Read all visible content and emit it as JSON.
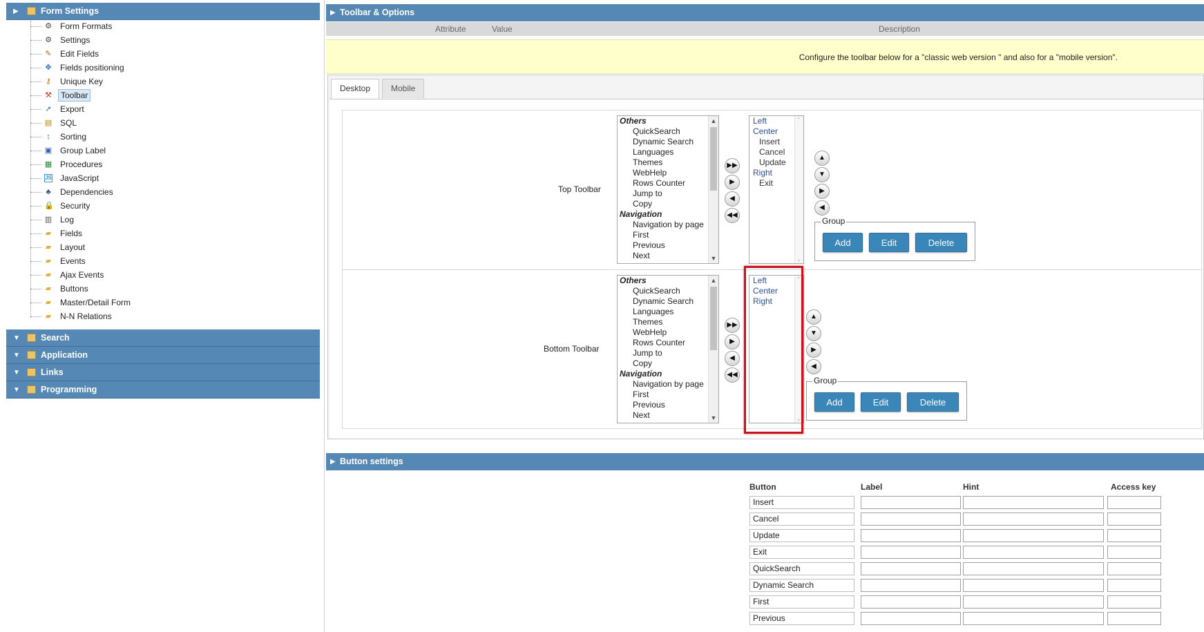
{
  "left": {
    "header": "Form Settings",
    "items": [
      {
        "label": "Form Formats",
        "icon": "gear-icon",
        "glyph": "⚙",
        "color": "#444"
      },
      {
        "label": "Settings",
        "icon": "gear-icon",
        "glyph": "⚙",
        "color": "#444"
      },
      {
        "label": "Edit Fields",
        "icon": "pencil-icon",
        "glyph": "✎",
        "color": "#b5651d"
      },
      {
        "label": "Fields positioning",
        "icon": "move-icon",
        "glyph": "✥",
        "color": "#2d6fb7"
      },
      {
        "label": "Unique Key",
        "icon": "key-icon",
        "glyph": "⚷",
        "color": "#b08a00"
      },
      {
        "label": "Toolbar",
        "icon": "tools-icon",
        "glyph": "⚒",
        "color": "#c0392b",
        "selected": true
      },
      {
        "label": "Export",
        "icon": "export-icon",
        "glyph": "➚",
        "color": "#2d6fb7"
      },
      {
        "label": "SQL",
        "icon": "database-icon",
        "glyph": "▤",
        "color": "#b08a00"
      },
      {
        "label": "Sorting",
        "icon": "sort-icon",
        "glyph": "↕",
        "color": "#1a9a7a"
      },
      {
        "label": "Group Label",
        "icon": "group-label-icon",
        "glyph": "▣",
        "color": "#2d5fb7"
      },
      {
        "label": "Procedures",
        "icon": "procedure-icon",
        "glyph": "▦",
        "color": "#2e8b3a"
      },
      {
        "label": "JavaScript",
        "icon": "javascript-icon",
        "glyph": "JS",
        "color": "#3a8fd0"
      },
      {
        "label": "Dependencies",
        "icon": "dependency-icon",
        "glyph": "♣",
        "color": "#3a4f8a"
      },
      {
        "label": "Security",
        "icon": "lock-icon",
        "glyph": "🔒",
        "color": "#b08a00"
      },
      {
        "label": "Log",
        "icon": "log-icon",
        "glyph": "▥",
        "color": "#555"
      },
      {
        "label": "Fields",
        "icon": "folder-icon",
        "glyph": "▰",
        "color": "#e0b040"
      },
      {
        "label": "Layout",
        "icon": "folder-icon",
        "glyph": "▰",
        "color": "#e0b040"
      },
      {
        "label": "Events",
        "icon": "folder-icon",
        "glyph": "▰",
        "color": "#e0b040"
      },
      {
        "label": "Ajax Events",
        "icon": "folder-icon",
        "glyph": "▰",
        "color": "#e0b040"
      },
      {
        "label": "Buttons",
        "icon": "folder-icon",
        "glyph": "▰",
        "color": "#e0b040"
      },
      {
        "label": "Master/Detail Form",
        "icon": "folder-icon",
        "glyph": "▰",
        "color": "#e0b040"
      },
      {
        "label": "N-N Relations",
        "icon": "folder-icon",
        "glyph": "▰",
        "color": "#e0b040"
      }
    ],
    "sections": [
      "Search",
      "Application",
      "Links",
      "Programming"
    ]
  },
  "toolbar_options": {
    "header": "Toolbar & Options",
    "col_attribute": "Attribute",
    "col_value": "Value",
    "col_description": "Description",
    "info": "Configure the toolbar below for a \"classic web version \" and also for a \"mobile version\".",
    "tabs": [
      "Desktop",
      "Mobile"
    ],
    "top_label": "Top Toolbar",
    "bottom_label": "Bottom Toolbar",
    "available": [
      {
        "text": "Others",
        "group": true
      },
      {
        "text": "QuickSearch"
      },
      {
        "text": "Dynamic Search"
      },
      {
        "text": "Languages"
      },
      {
        "text": "Themes"
      },
      {
        "text": "WebHelp"
      },
      {
        "text": "Rows Counter"
      },
      {
        "text": "Jump to"
      },
      {
        "text": "Copy"
      },
      {
        "text": "Navigation",
        "group": true
      },
      {
        "text": "Navigation by page"
      },
      {
        "text": "First"
      },
      {
        "text": "Previous"
      },
      {
        "text": "Next"
      }
    ],
    "top_selected": [
      {
        "text": "Left",
        "type": "grp"
      },
      {
        "text": "Center",
        "type": "grp"
      },
      {
        "text": "Insert",
        "type": "sub"
      },
      {
        "text": "Cancel",
        "type": "sub"
      },
      {
        "text": "Update",
        "type": "sub"
      },
      {
        "text": "Right",
        "type": "grp"
      },
      {
        "text": "Exit",
        "type": "sub"
      }
    ],
    "bottom_selected": [
      {
        "text": "Left",
        "type": "grp"
      },
      {
        "text": "Center",
        "type": "grp"
      },
      {
        "text": "Right",
        "type": "grp"
      }
    ],
    "group_label": "Group",
    "add": "Add",
    "edit": "Edit",
    "delete": "Delete"
  },
  "button_settings": {
    "header": "Button settings",
    "col_button": "Button",
    "col_label": "Label",
    "col_hint": "Hint",
    "col_access": "Access key",
    "rows": [
      "Insert",
      "Cancel",
      "Update",
      "Exit",
      "QuickSearch",
      "Dynamic Search",
      "First",
      "Previous"
    ]
  },
  "colors": {
    "header": "#5588b4",
    "button": "#3a86b8",
    "highlight": "#c8141c",
    "info_bg": "#ffffcc"
  }
}
